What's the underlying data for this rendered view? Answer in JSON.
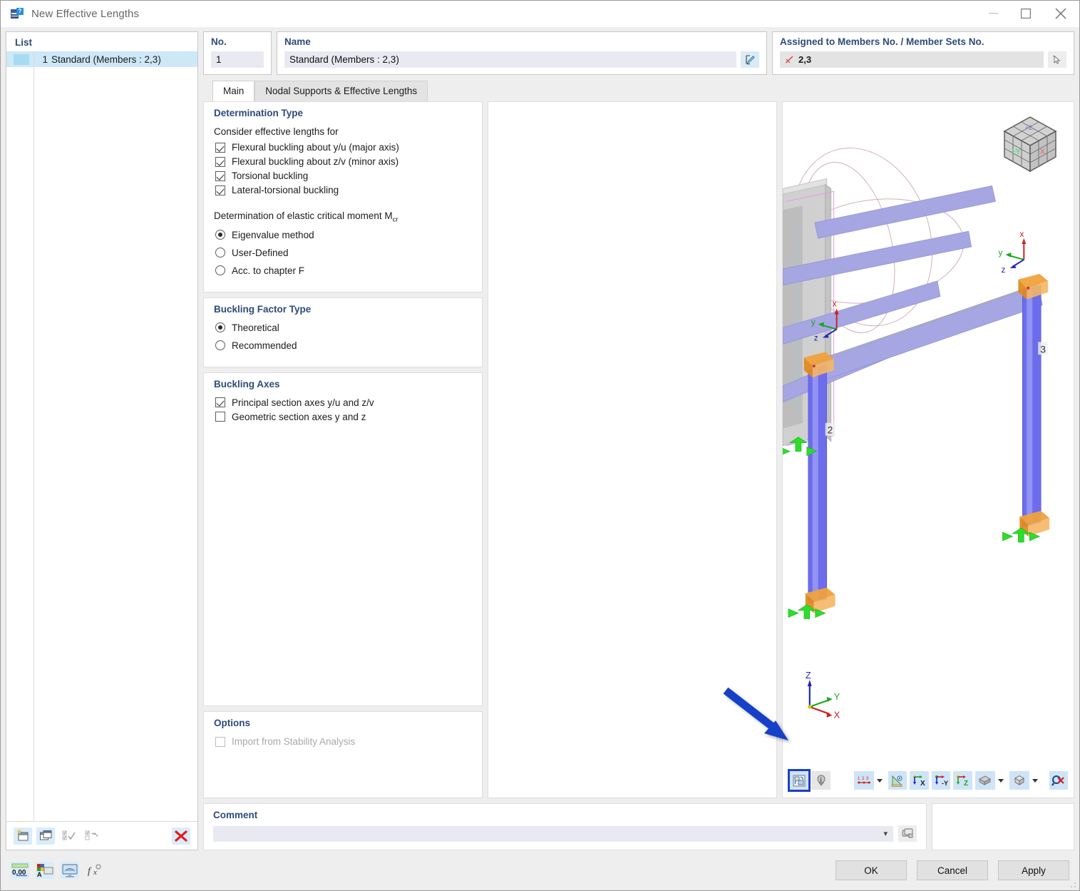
{
  "window": {
    "title": "New Effective Lengths",
    "icon": "effective-lengths-icon",
    "minimize": "minimize-icon",
    "maximize": "maximize-icon",
    "close": "close-icon"
  },
  "list_panel": {
    "header": "List",
    "rows": [
      {
        "number": "1",
        "label": "Standard (Members : 2,3)",
        "selected": true
      }
    ],
    "toolbar": [
      {
        "name": "new-item-button",
        "icon": "new-window-icon",
        "enabled": true
      },
      {
        "name": "copy-item-button",
        "icon": "copy-window-icon",
        "enabled": true
      },
      {
        "name": "select-all-button",
        "icon": "check-all-icon",
        "enabled": false
      },
      {
        "name": "invert-selection-button",
        "icon": "invert-check-icon",
        "enabled": false
      },
      {
        "name": "delete-item-button",
        "icon": "red-x-icon",
        "enabled": true
      }
    ]
  },
  "fields": {
    "no_label": "No.",
    "no_value": "1",
    "name_label": "Name",
    "name_value": "Standard (Members : 2,3)",
    "name_edit_icon": "edit-pencil-icon",
    "assigned_label": "Assigned to Members No. / Member Sets No.",
    "assigned_value": "2,3",
    "assigned_prefix_icon": "member-icon",
    "assigned_pick_icon": "pick-cursor-icon"
  },
  "tabs": [
    {
      "label": "Main",
      "active": true
    },
    {
      "label": "Nodal Supports & Effective Lengths",
      "active": false
    }
  ],
  "determination_type": {
    "title": "Determination Type",
    "consider_label": "Consider effective lengths for",
    "checks": [
      {
        "label": "Flexural buckling about y/u (major axis)",
        "checked": true
      },
      {
        "label": "Flexural buckling about z/v (minor axis)",
        "checked": true
      },
      {
        "label": "Torsional buckling",
        "checked": true
      },
      {
        "label": "Lateral-torsional buckling",
        "checked": true
      }
    ],
    "mcr_label_pre": "Determination of elastic critical moment M",
    "mcr_label_sub": "cr",
    "radios": [
      {
        "label": "Eigenvalue method",
        "selected": true
      },
      {
        "label": "User-Defined",
        "selected": false
      },
      {
        "label": "Acc. to chapter F",
        "selected": false
      }
    ]
  },
  "buckling_factor_type": {
    "title": "Buckling Factor Type",
    "radios": [
      {
        "label": "Theoretical",
        "selected": true
      },
      {
        "label": "Recommended",
        "selected": false
      }
    ]
  },
  "buckling_axes": {
    "title": "Buckling Axes",
    "checks": [
      {
        "label": "Principal section axes y/u and z/v",
        "checked": true
      },
      {
        "label": "Geometric section axes y and z",
        "checked": false
      }
    ]
  },
  "options": {
    "title": "Options",
    "checks": [
      {
        "label": "Import from Stability Analysis",
        "checked": false,
        "disabled": true
      }
    ]
  },
  "comment": {
    "title": "Comment",
    "value": "",
    "placeholder": "",
    "dropdown_icon": "chevron-down-icon",
    "picker_icon": "comment-library-icon"
  },
  "viewport": {
    "members": [
      {
        "label": "2"
      },
      {
        "label": "3"
      }
    ],
    "local_axes": [
      {
        "x": "x",
        "y": "y",
        "z": "z"
      }
    ],
    "global_axes": {
      "x": "X",
      "y": "Y",
      "z": "Z"
    },
    "viewcube": {
      "left_face": "+Y",
      "right_face": "-X",
      "top_face": "+Z"
    },
    "colors": {
      "member": "#9a9ae0",
      "column": "#6c6cec",
      "support": "#2ddc2d",
      "hinge": "#f08a20",
      "highlight": "#1e3fc4"
    },
    "toolbar": [
      {
        "name": "render-mode-button",
        "icon": "render-toggle-icon",
        "selected": true
      },
      {
        "name": "info-button",
        "icon": "info-balloon-icon",
        "selected": false
      },
      {
        "name": "numbering-button",
        "icon": "numbering-123-icon",
        "selected": false,
        "dropdown": true
      },
      {
        "name": "view-settings-button",
        "icon": "view-eye-icon",
        "selected": false
      },
      {
        "name": "view-x-button",
        "icon": "axis-x-icon",
        "selected": false
      },
      {
        "name": "view-y-button",
        "icon": "axis-minus-y-icon",
        "selected": false
      },
      {
        "name": "view-z-button",
        "icon": "axis-z-icon",
        "selected": false
      },
      {
        "name": "section-button",
        "icon": "layers-icon",
        "selected": false,
        "dropdown": true
      },
      {
        "name": "box-view-button",
        "icon": "cube-icon",
        "selected": false,
        "dropdown": true
      },
      {
        "name": "reset-view-button",
        "icon": "magnifier-x-icon",
        "selected": false
      }
    ]
  },
  "footer": {
    "tools": [
      {
        "name": "decimal-places-button",
        "icon": "numeric-0-00-icon"
      },
      {
        "name": "units-button",
        "icon": "units-icon"
      },
      {
        "name": "display-settings-button",
        "icon": "monitor-icon"
      },
      {
        "name": "formula-button",
        "icon": "fx-icon"
      }
    ],
    "buttons": [
      {
        "label": "OK",
        "name": "ok-button"
      },
      {
        "label": "Cancel",
        "name": "cancel-button"
      },
      {
        "label": "Apply",
        "name": "apply-button"
      }
    ]
  }
}
